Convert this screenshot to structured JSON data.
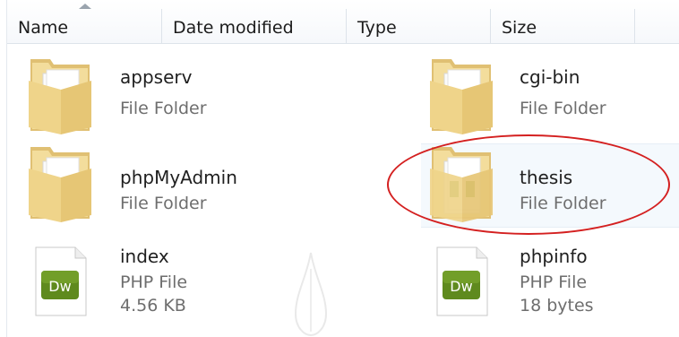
{
  "columns": [
    {
      "label": "Name"
    },
    {
      "label": "Date modified"
    },
    {
      "label": "Type"
    },
    {
      "label": "Size"
    }
  ],
  "items": [
    {
      "name": "appserv",
      "type": "File Folder",
      "icon": "folder-icon"
    },
    {
      "name": "cgi-bin",
      "type": "File Folder",
      "icon": "folder-icon"
    },
    {
      "name": "phpMyAdmin",
      "type": "File Folder",
      "icon": "folder-icon"
    },
    {
      "name": "thesis",
      "type": "File Folder",
      "icon": "folder-icon",
      "highlighted": true
    },
    {
      "name": "index",
      "type": "PHP File",
      "size": "4.56 KB",
      "icon": "dreamweaver-file-icon",
      "icon_label": "Dw"
    },
    {
      "name": "phpinfo",
      "type": "PHP File",
      "size": "18 bytes",
      "icon": "dreamweaver-file-icon",
      "icon_label": "Dw"
    }
  ],
  "colors": {
    "highlight_circle": "#d42020",
    "dw_green": "#5f8a1e"
  }
}
